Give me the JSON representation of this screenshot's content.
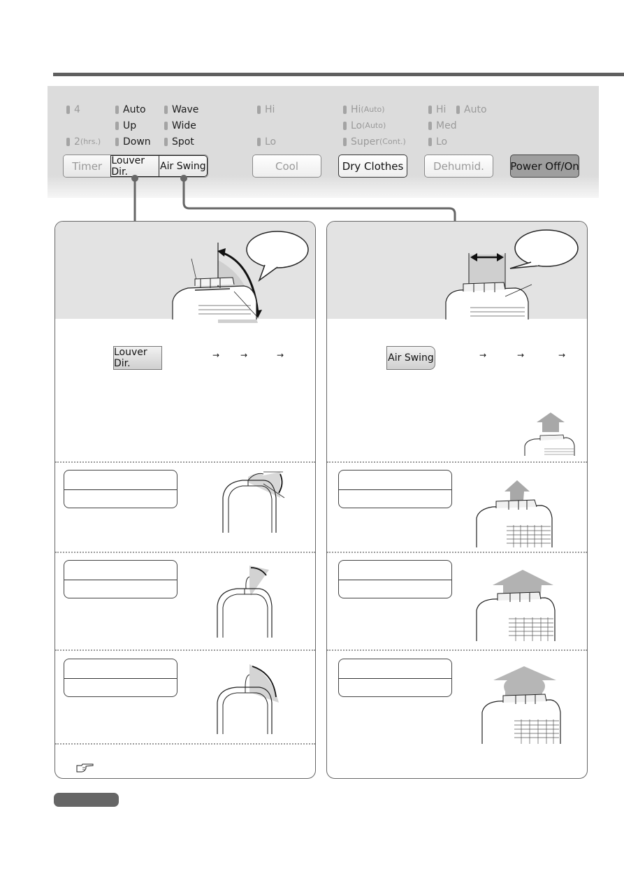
{
  "control_panel": {
    "timer": {
      "button_label": "Timer",
      "indicators": [
        {
          "label": "4",
          "suffix": ""
        },
        {
          "label": "2",
          "suffix": "(hrs.)"
        }
      ]
    },
    "louver_dir": {
      "button_label": "Louver Dir.",
      "indicators": [
        {
          "label": "Auto"
        },
        {
          "label": "Up"
        },
        {
          "label": "Down"
        }
      ]
    },
    "air_swing": {
      "button_label": "Air Swing",
      "indicators": [
        {
          "label": "Wave"
        },
        {
          "label": "Wide"
        },
        {
          "label": "Spot"
        }
      ]
    },
    "cool": {
      "button_label": "Cool",
      "indicators": [
        {
          "label": "Hi"
        },
        {
          "label": "Lo"
        }
      ]
    },
    "dry_clothes": {
      "button_label": "Dry Clothes",
      "indicators": [
        {
          "label": "Hi",
          "suffix": "(Auto)"
        },
        {
          "label": "Lo",
          "suffix": "(Auto)"
        },
        {
          "label": "Super",
          "suffix": "(Cont.)"
        }
      ]
    },
    "dehumid": {
      "button_label": "Dehumid.",
      "indicators": [
        {
          "label": "Hi"
        },
        {
          "label": "Auto"
        },
        {
          "label": "Med"
        },
        {
          "label": "Lo"
        }
      ]
    },
    "power": {
      "button_label": "Power Off/On"
    }
  },
  "left_card": {
    "press_button_label": "Louver Dir.",
    "sequence_arrows": [
      "→",
      "→",
      "→"
    ],
    "pointer_icon": "hand-pointer-icon"
  },
  "right_card": {
    "press_button_label": "Air Swing",
    "sequence_arrows": [
      "→",
      "→",
      "→"
    ]
  },
  "colors": {
    "panel_bg": "#dcdcdc",
    "rule": "#5f5f5f",
    "power_button": "#9e9e9e",
    "note_pill": "#666666"
  }
}
